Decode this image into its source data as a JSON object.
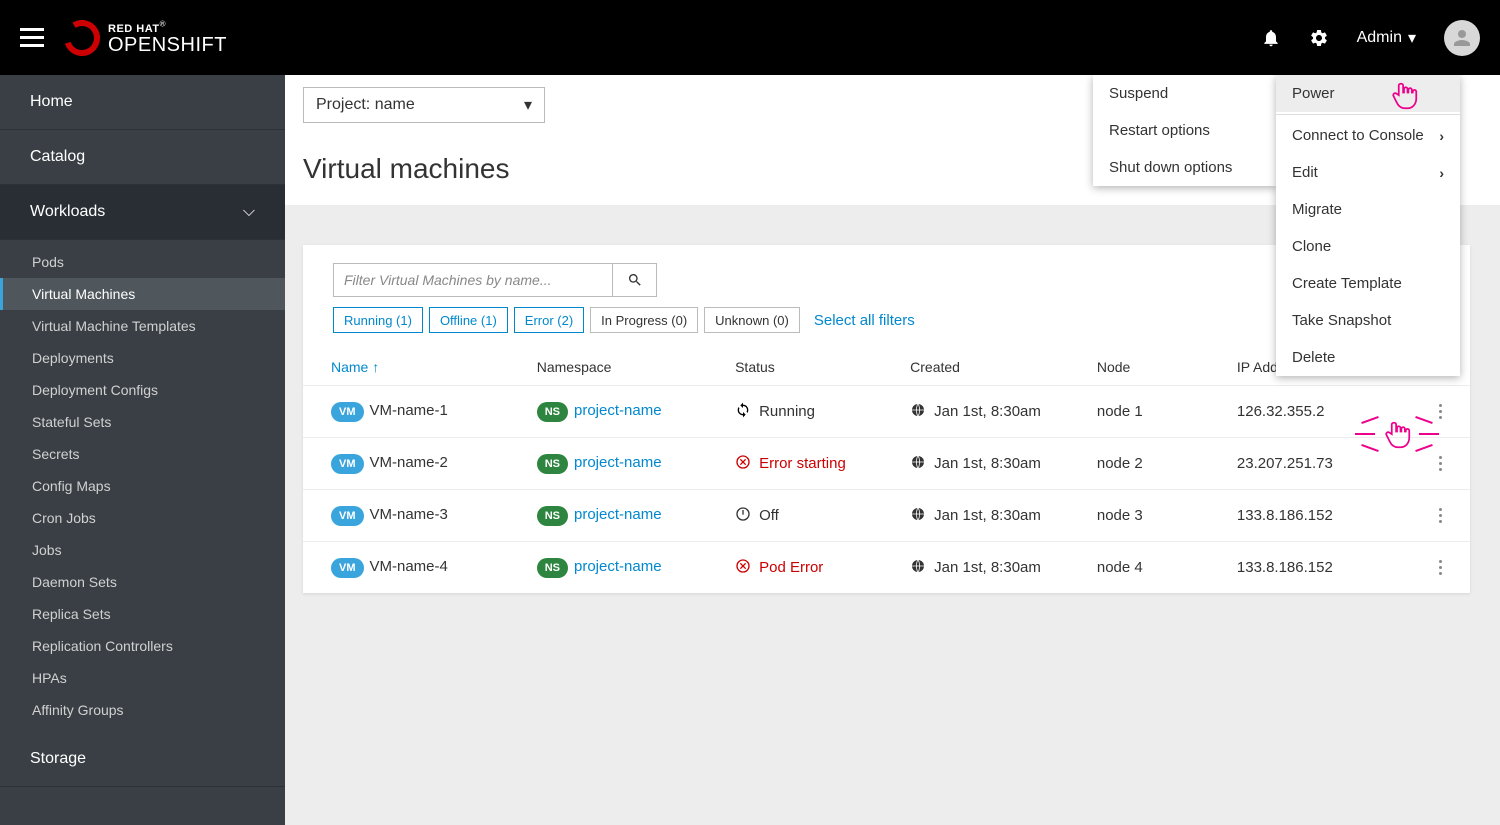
{
  "brand": {
    "line1": "RED HAT",
    "line2": "OPENSHIFT"
  },
  "topbar": {
    "admin": "Admin"
  },
  "sidebar": {
    "home": "Home",
    "catalog": "Catalog",
    "workloads": "Workloads",
    "storage": "Storage",
    "items": [
      "Pods",
      "Virtual Machines",
      "Virtual Machine Templates",
      "Deployments",
      "Deployment Configs",
      "Stateful Sets",
      "Secrets",
      "Config Maps",
      "Cron Jobs",
      "Jobs",
      "Daemon Sets",
      "Replica Sets",
      "Replication Controllers",
      "HPAs",
      "Affinity Groups"
    ]
  },
  "project_selector": "Project: name",
  "page_title": "Virtual machines",
  "filter": {
    "placeholder": "Filter Virtual Machines by name...",
    "chips": [
      {
        "label": "Running (1)",
        "active": true
      },
      {
        "label": "Offline (1)",
        "active": true
      },
      {
        "label": "Error (2)",
        "active": true
      },
      {
        "label": "In Progress (0)",
        "active": false
      },
      {
        "label": "Unknown (0)",
        "active": false
      }
    ],
    "select_all": "Select all filters"
  },
  "table": {
    "headers": [
      "Name",
      "Namespace",
      "Status",
      "Created",
      "Node",
      "IP Address",
      ""
    ],
    "sort_col": 0,
    "rows": [
      {
        "name": "VM-name-1",
        "ns": "project-name",
        "status": "Running",
        "status_kind": "running",
        "created": "Jan 1st, 8:30am",
        "node": "node 1",
        "ip": "126.32.355.2"
      },
      {
        "name": "VM-name-2",
        "ns": "project-name",
        "status": "Error starting",
        "status_kind": "error",
        "created": "Jan 1st, 8:30am",
        "node": "node 2",
        "ip": "23.207.251.73"
      },
      {
        "name": "VM-name-3",
        "ns": "project-name",
        "status": "Off",
        "status_kind": "off",
        "created": "Jan 1st, 8:30am",
        "node": "node 3",
        "ip": "133.8.186.152"
      },
      {
        "name": "VM-name-4",
        "ns": "project-name",
        "status": "Pod Error",
        "status_kind": "error",
        "created": "Jan 1st, 8:30am",
        "node": "node 4",
        "ip": "133.8.186.152"
      }
    ],
    "vm_badge": "VM",
    "ns_badge": "NS"
  },
  "submenu": {
    "items": [
      "Suspend",
      "Restart options",
      "Shut down options"
    ]
  },
  "context_menu": {
    "items": [
      {
        "label": "Power",
        "chevron": false,
        "highlight": true
      },
      {
        "label": "Connect to Console",
        "chevron": true
      },
      {
        "label": "Edit",
        "chevron": true
      },
      {
        "label": "Migrate",
        "chevron": false
      },
      {
        "label": "Clone",
        "chevron": false
      },
      {
        "label": "Create Template",
        "chevron": false
      },
      {
        "label": "Take Snapshot",
        "chevron": false
      },
      {
        "label": "Delete",
        "chevron": false
      }
    ]
  }
}
